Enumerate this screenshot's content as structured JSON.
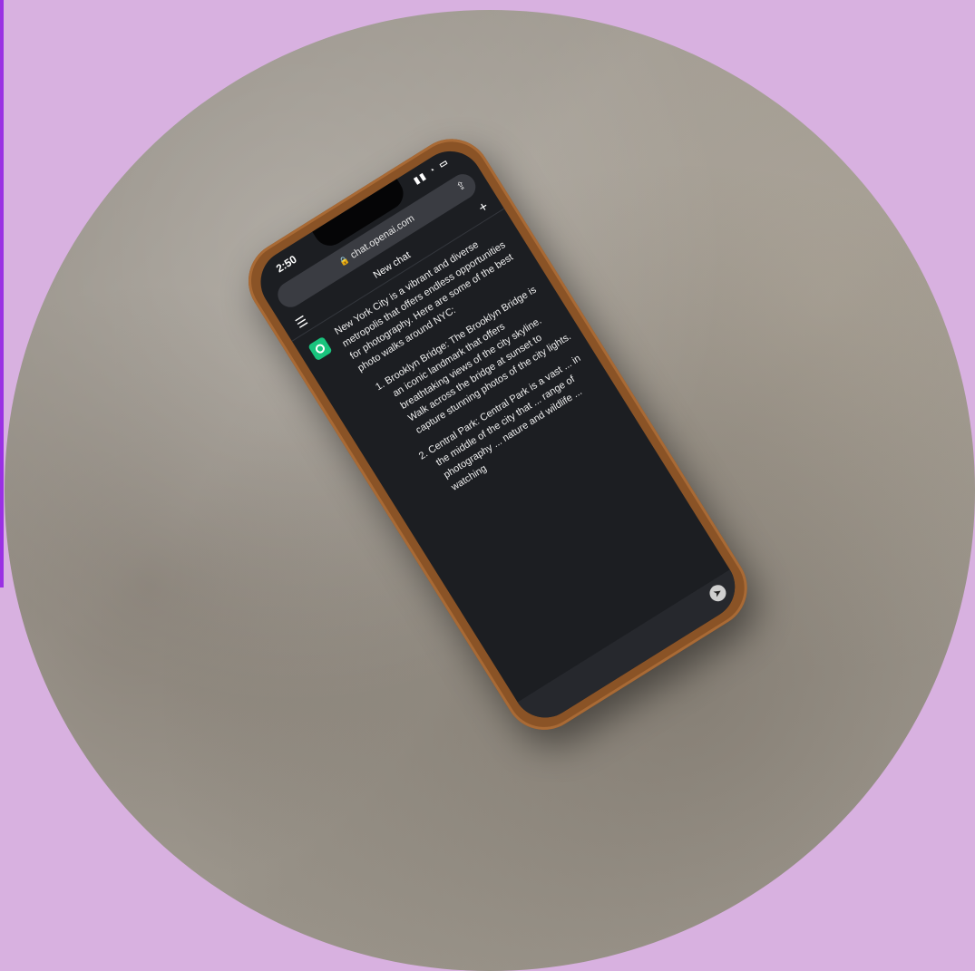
{
  "phone": {
    "time": "2:50",
    "url": "chat.openai.com",
    "chat_title": "New chat",
    "intro": "New York City is a vibrant and diverse metropolis that offers endless opportunities for photography. Here are some of the best photo walks around NYC:",
    "items": [
      {
        "text": "Brooklyn Bridge: The Brooklyn Bridge is an iconic landmark that offers breathtaking views of the city skyline. Walk across the bridge at sunset to capture stunning photos of the city lights."
      },
      {
        "text": "Central Park: Central Park is a vast ... in the middle of the city that ... range of photography ... nature and wildlife ... watching"
      }
    ],
    "icons": {
      "lock": "lock-icon",
      "share": "share-icon",
      "menu": "hamburger-menu-icon",
      "plus": "plus-icon",
      "send": "send-icon",
      "avatar": "chatgpt-logo-icon"
    }
  },
  "colors": {
    "background": "#d8b1e0",
    "accent_edge": "#9a31e3",
    "phone_case": "#8a5326",
    "screen": "#1c1e22"
  }
}
